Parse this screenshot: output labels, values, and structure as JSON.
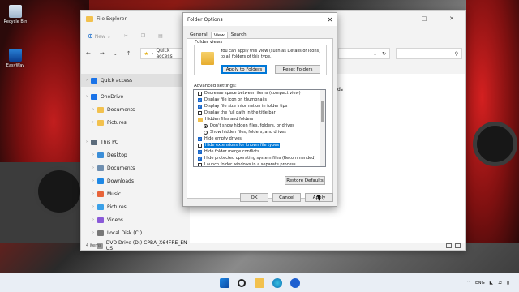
{
  "desktop": {
    "icons": [
      {
        "label": "Recycle Bin",
        "icon": "recycle-bin-icon"
      },
      {
        "label": "EasyWay",
        "icon": "app-icon"
      }
    ]
  },
  "explorer": {
    "title": "File Explorer",
    "cmd_new": "New",
    "addr_path": "Quick access",
    "nav": [
      {
        "label": "Quick access",
        "icon": "star-icon",
        "chev": true,
        "selected": true
      },
      {
        "label": "OneDrive",
        "icon": "cloud-icon",
        "chev": true
      },
      {
        "label": "Documents",
        "icon": "folder-icon",
        "chev": true
      },
      {
        "label": "Pictures",
        "icon": "folder-icon",
        "chev": true
      },
      {
        "label": "This PC",
        "icon": "pc-icon",
        "chev": true
      },
      {
        "label": "Desktop",
        "icon": "desktop-icon",
        "chev": true
      },
      {
        "label": "Documents",
        "icon": "documents-icon",
        "chev": true
      },
      {
        "label": "Downloads",
        "icon": "downloads-icon",
        "chev": true
      },
      {
        "label": "Music",
        "icon": "music-icon",
        "chev": true
      },
      {
        "label": "Pictures",
        "icon": "pictures-icon",
        "chev": true
      },
      {
        "label": "Videos",
        "icon": "videos-icon",
        "chev": true
      },
      {
        "label": "Local Disk (C:)",
        "icon": "disk-icon",
        "chev": true
      },
      {
        "label": "DVD Drive (D:) CPBA_X64FRE_EN-US",
        "icon": "dvd-icon",
        "chev": true
      }
    ],
    "main_partial_text": "ds",
    "status": "4 items"
  },
  "dialog": {
    "title": "Folder Options",
    "tabs": [
      "General",
      "View",
      "Search"
    ],
    "active_tab": "View",
    "folder_views_label": "Folder views",
    "folder_views_text": "You can apply this view (such as Details or Icons) to all folders of this type.",
    "apply_label": "Apply to Folders",
    "reset_label": "Reset Folders",
    "advanced_label": "Advanced settings:",
    "advanced": [
      {
        "type": "checkbox",
        "checked": false,
        "label": "Decrease space between items (compact view)"
      },
      {
        "type": "checkbox",
        "checked": true,
        "label": "Display file icon on thumbnails"
      },
      {
        "type": "checkbox",
        "checked": true,
        "label": "Display file size information in folder tips"
      },
      {
        "type": "checkbox",
        "checked": false,
        "label": "Display the full path in the title bar"
      },
      {
        "type": "folder",
        "label": "Hidden files and folders"
      },
      {
        "type": "radio",
        "checked": true,
        "label": "Don't show hidden files, folders, or drives"
      },
      {
        "type": "radio",
        "checked": false,
        "label": "Show hidden files, folders, and drives"
      },
      {
        "type": "checkbox",
        "checked": true,
        "label": "Hide empty drives"
      },
      {
        "type": "checkbox",
        "checked": false,
        "label": "Hide extensions for known file types",
        "highlight": true
      },
      {
        "type": "checkbox",
        "checked": true,
        "label": "Hide folder merge conflicts"
      },
      {
        "type": "checkbox",
        "checked": true,
        "label": "Hide protected operating system files (Recommended)"
      },
      {
        "type": "checkbox",
        "checked": false,
        "label": "Launch folder windows in a separate process"
      }
    ],
    "restore_label": "Restore Defaults",
    "ok_label": "OK",
    "cancel_label": "Cancel",
    "apply_btn_label": "Apply"
  },
  "taskbar": {
    "lang": "ENG",
    "time": "",
    "date": ""
  },
  "colors": {
    "accent": "#0078d7",
    "checkbox": "#1a67c9",
    "folder": "#f2c14e"
  }
}
